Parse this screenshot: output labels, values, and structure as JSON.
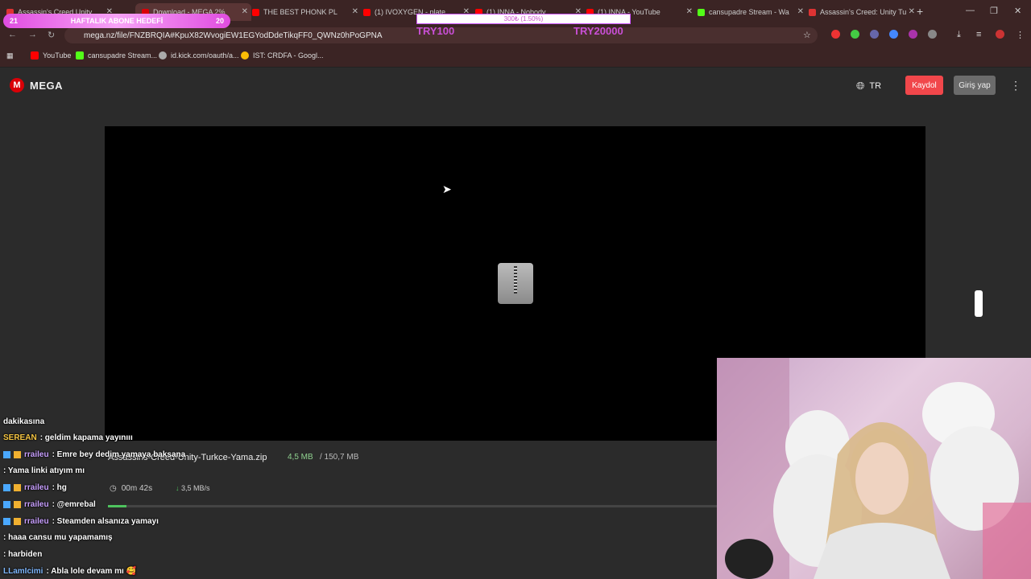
{
  "browser": {
    "tabs": [
      {
        "title": "Assassin's Creed Unity",
        "fav": "#d33"
      },
      {
        "title": "Download - MEGA 2%",
        "fav": "#d90007",
        "active": true
      },
      {
        "title": "THE BEST PHONK PL",
        "fav": "#f00"
      },
      {
        "title": "(1) IVOXYGEN - plate",
        "fav": "#f00"
      },
      {
        "title": "(1) INNA - Nobody",
        "fav": "#f00"
      },
      {
        "title": "(1) INNA - YouTube",
        "fav": "#f00"
      },
      {
        "title": "cansupadre Stream - Wa",
        "fav": "#53fc18"
      },
      {
        "title": "Assassin's Creed: Unity Tu",
        "fav": "#d33"
      }
    ],
    "url": "mega.nz/file/FNZBRQIA#KpuX82WvogiEW1EGYodDdeTikqFF0_QWNz0hPoGPNA",
    "bookmarks": [
      "YouTube",
      "cansupadre Stream...",
      "id.kick.com/oauth/a...",
      "IST: CRDFA - Googl..."
    ]
  },
  "overlay": {
    "banner_left": "21",
    "banner_text": "HAFTALIK ABONE HEDEFİ",
    "banner_right": "20",
    "progress_text": "300₺ (1.50%)",
    "try_left": "TRY100",
    "try_right": "TRY20000"
  },
  "mega": {
    "logo_letter": "M",
    "logo_text": "MEGA",
    "language": "TR",
    "signup_label": "Kaydol",
    "login_label": "Giriş yap",
    "file_name": "Assassins-Creed-Unity-Turkce-Yama.zip",
    "downloaded": "4,5 MB",
    "total_size": "/ 150,7 MB",
    "time_left": "00m 42s",
    "speed": "3,5 MB/s",
    "progress_fraction": 0.03
  },
  "chat": [
    {
      "user": "",
      "text": "dakikasına"
    },
    {
      "user": "SEREAN",
      "text": ": geldim kapama yayınııı"
    },
    {
      "user": "rraileu",
      "text": ": Emre bey dedim yamaya baksana"
    },
    {
      "user": "",
      "text": ": Yama linki atıyım mı"
    },
    {
      "user": "rraileu",
      "text": ": hg"
    },
    {
      "user": "rraileu",
      "text": ": @emrebal"
    },
    {
      "user": "rraileu",
      "text": ": Steamden alsanıza yamayı"
    },
    {
      "user": "",
      "text": ": haaa cansu mu yapamamış"
    },
    {
      "user": "",
      "text": ": harbiden"
    },
    {
      "user": "LLamIcimi",
      "text": ": Abla lole devam mı 🥰"
    }
  ]
}
